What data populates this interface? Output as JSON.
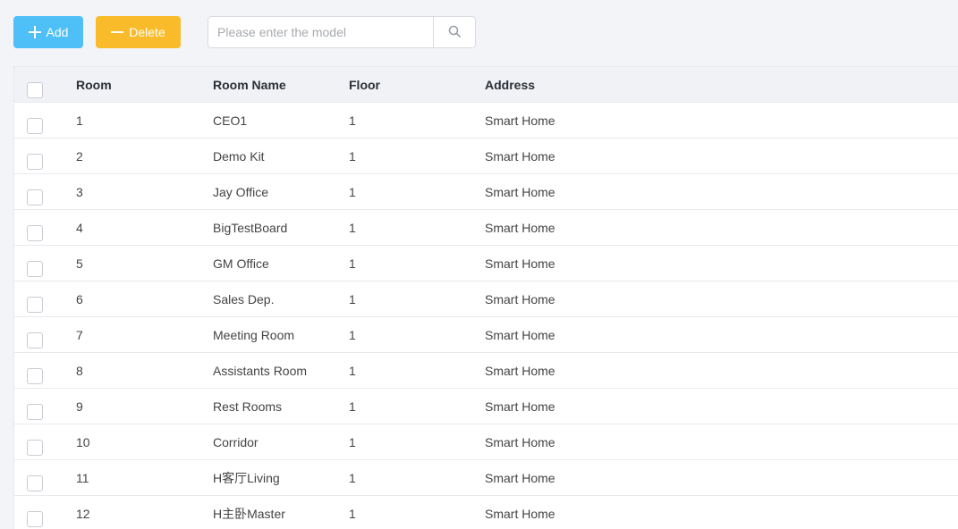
{
  "toolbar": {
    "add_label": "Add",
    "delete_label": "Delete",
    "search_placeholder": "Please enter the model",
    "search_value": ""
  },
  "colors": {
    "add_button": "#4fbff7",
    "delete_button": "#f9bb2a",
    "header_bg": "#f0f2f5",
    "page_bg": "#f3f4f8"
  },
  "icons": {
    "add": "plus-icon",
    "delete": "minus-icon",
    "search": "search-icon"
  },
  "table": {
    "columns": [
      "Room",
      "Room Name",
      "Floor",
      "Address"
    ],
    "rows": [
      {
        "room": "1",
        "name": "CEO1",
        "floor": "1",
        "address": "Smart Home"
      },
      {
        "room": "2",
        "name": "Demo Kit",
        "floor": "1",
        "address": "Smart Home"
      },
      {
        "room": "3",
        "name": "Jay Office",
        "floor": "1",
        "address": "Smart Home"
      },
      {
        "room": "4",
        "name": "BigTestBoard",
        "floor": "1",
        "address": "Smart Home"
      },
      {
        "room": "5",
        "name": "GM Office",
        "floor": "1",
        "address": "Smart Home"
      },
      {
        "room": "6",
        "name": "Sales Dep.",
        "floor": "1",
        "address": "Smart Home"
      },
      {
        "room": "7",
        "name": "Meeting Room",
        "floor": "1",
        "address": "Smart Home"
      },
      {
        "room": "8",
        "name": "Assistants Room",
        "floor": "1",
        "address": "Smart Home"
      },
      {
        "room": "9",
        "name": "Rest Rooms",
        "floor": "1",
        "address": "Smart Home"
      },
      {
        "room": "10",
        "name": "Corridor",
        "floor": "1",
        "address": "Smart Home"
      },
      {
        "room": "11",
        "name": "H客厅Living",
        "floor": "1",
        "address": "Smart Home"
      },
      {
        "room": "12",
        "name": "H主卧Master",
        "floor": "1",
        "address": "Smart Home"
      }
    ]
  }
}
